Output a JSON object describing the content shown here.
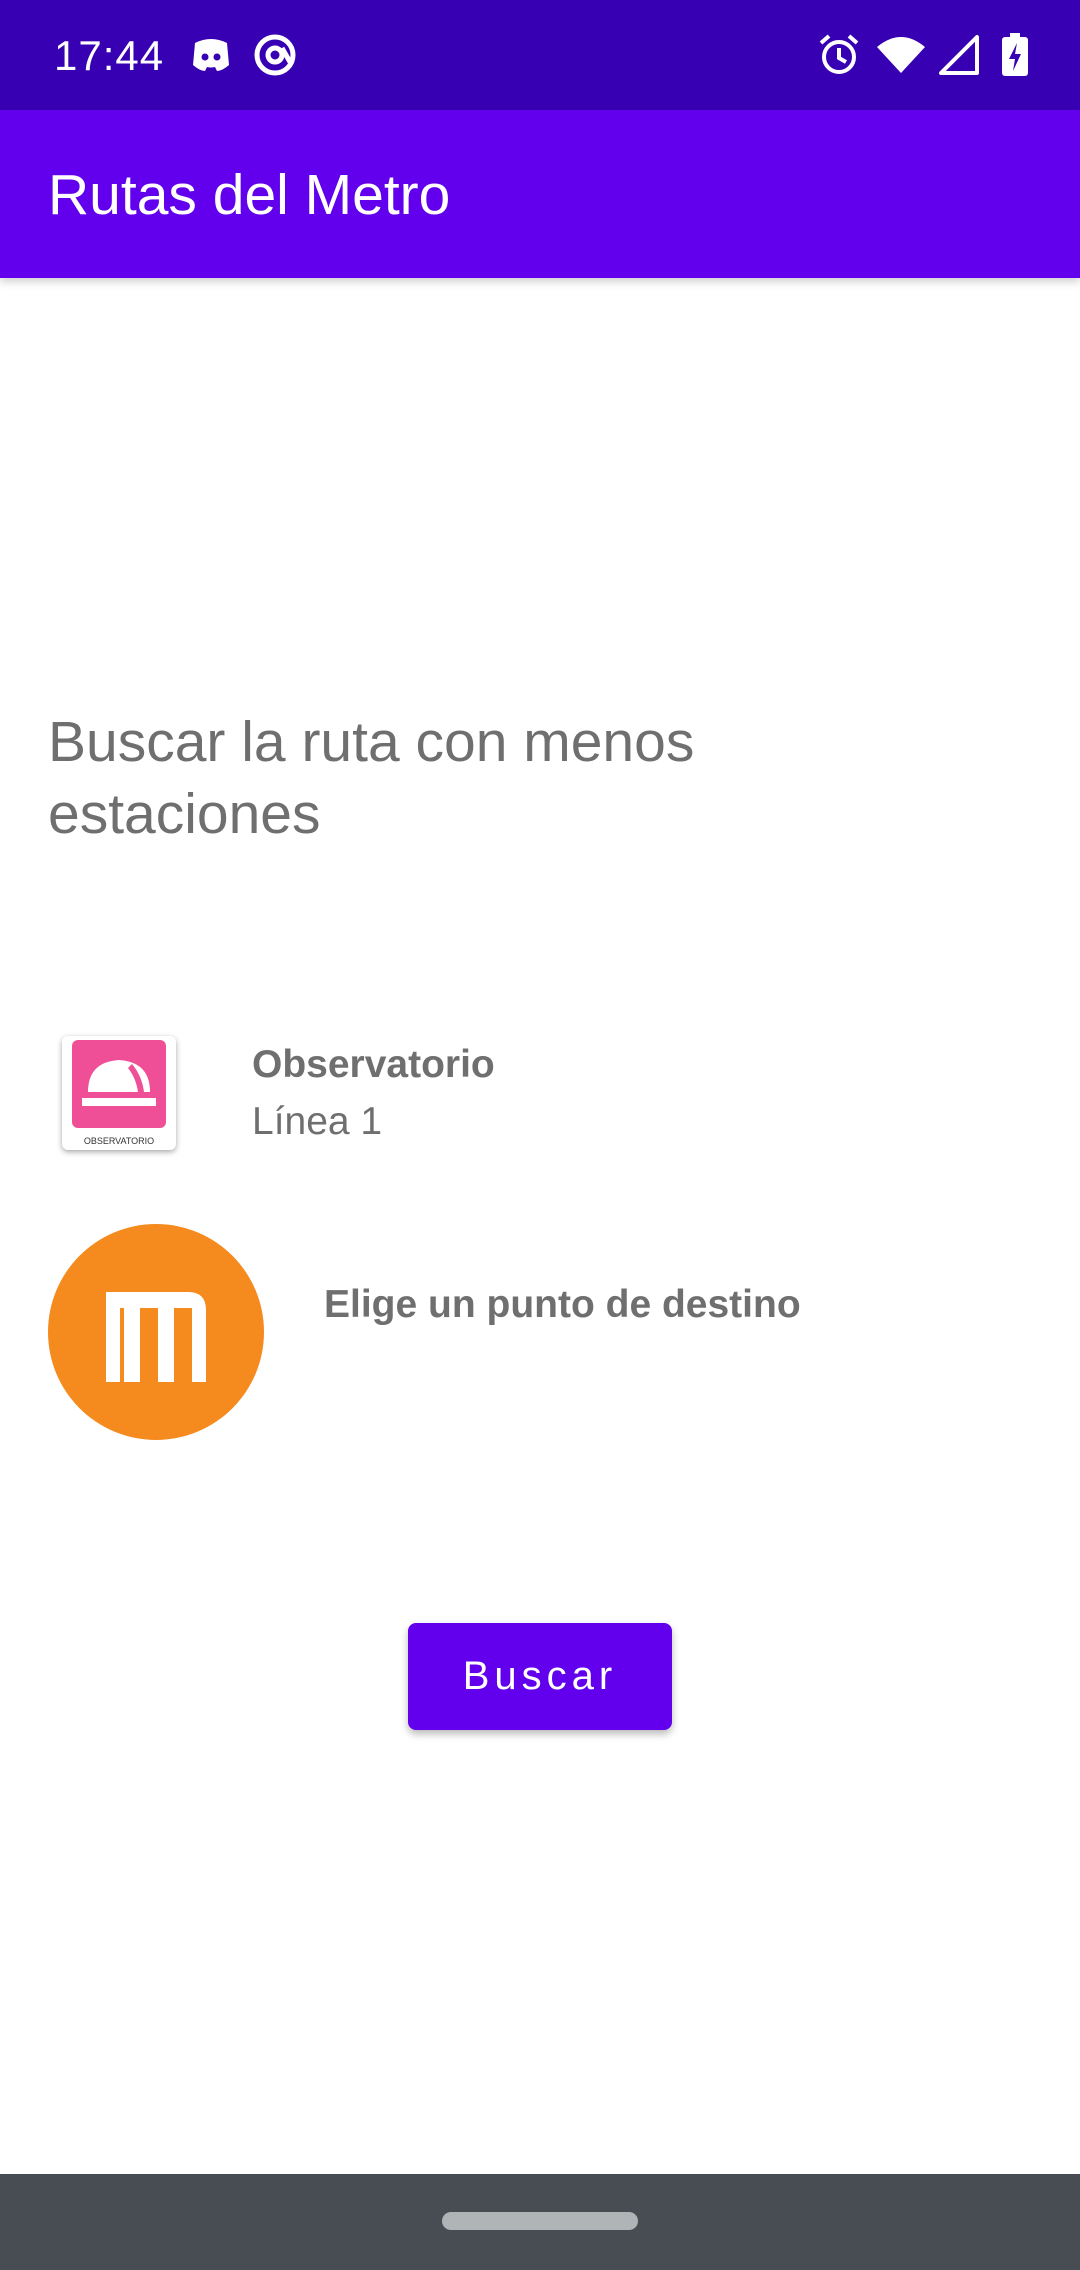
{
  "status_bar": {
    "time": "17:44",
    "left_icons": [
      "discord-icon",
      "at-sign-icon"
    ],
    "right_icons": [
      "alarm-icon",
      "wifi-icon",
      "cellular-signal-icon",
      "battery-charging-icon"
    ]
  },
  "app_bar": {
    "title": "Rutas del Metro"
  },
  "main": {
    "heading": "Buscar la ruta con menos estaciones",
    "origin": {
      "station": "Observatorio",
      "line": "Línea 1",
      "logo_caption": "OBSERVATORIO",
      "logo_color": "#ef4f97"
    },
    "destination": {
      "prompt": "Elige un punto de destino",
      "logo_color": "#f58b1f"
    },
    "search_label": "Buscar"
  },
  "colors": {
    "status_bar": "#3700b3",
    "primary": "#6200ee",
    "text_secondary": "#6f6f6f",
    "nav_bar": "#474d52"
  }
}
